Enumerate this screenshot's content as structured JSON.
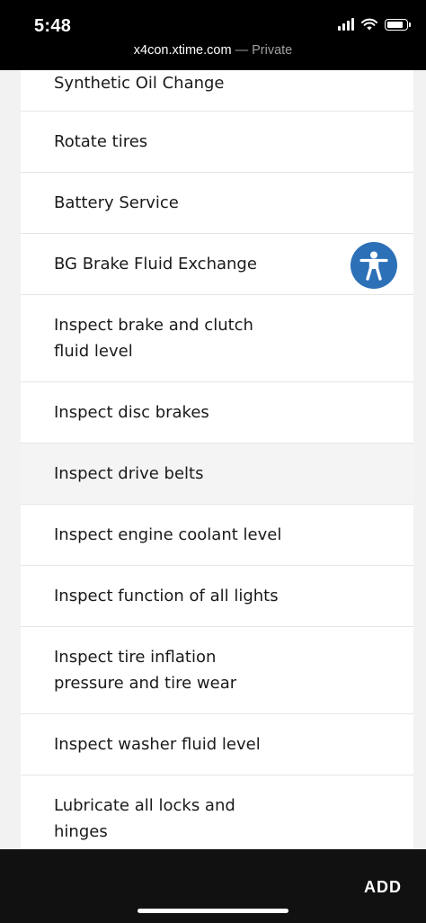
{
  "status_bar": {
    "time": "5:48",
    "icons": [
      "cellular-signal-icon",
      "wifi-icon",
      "battery-icon"
    ]
  },
  "browser": {
    "domain": "x4con.xtime.com",
    "separator": " — ",
    "mode": "Private"
  },
  "services": {
    "items": [
      {
        "label": "Synthetic Oil Change"
      },
      {
        "label": "Rotate tires"
      },
      {
        "label": "Battery Service"
      },
      {
        "label": "BG Brake Fluid Exchange"
      },
      {
        "label": "Inspect brake and clutch fluid level"
      },
      {
        "label": "Inspect disc brakes"
      },
      {
        "label": "Inspect drive belts"
      },
      {
        "label": "Inspect engine coolant level"
      },
      {
        "label": "Inspect function of all lights"
      },
      {
        "label": "Inspect tire inflation pressure and tire wear"
      },
      {
        "label": "Inspect washer fluid level"
      },
      {
        "label": "Lubricate all locks and hinges"
      }
    ]
  },
  "accessibility": {
    "icon": "accessibility-person-icon",
    "color": "#2c70b8"
  },
  "footer": {
    "add_label": "ADD"
  }
}
